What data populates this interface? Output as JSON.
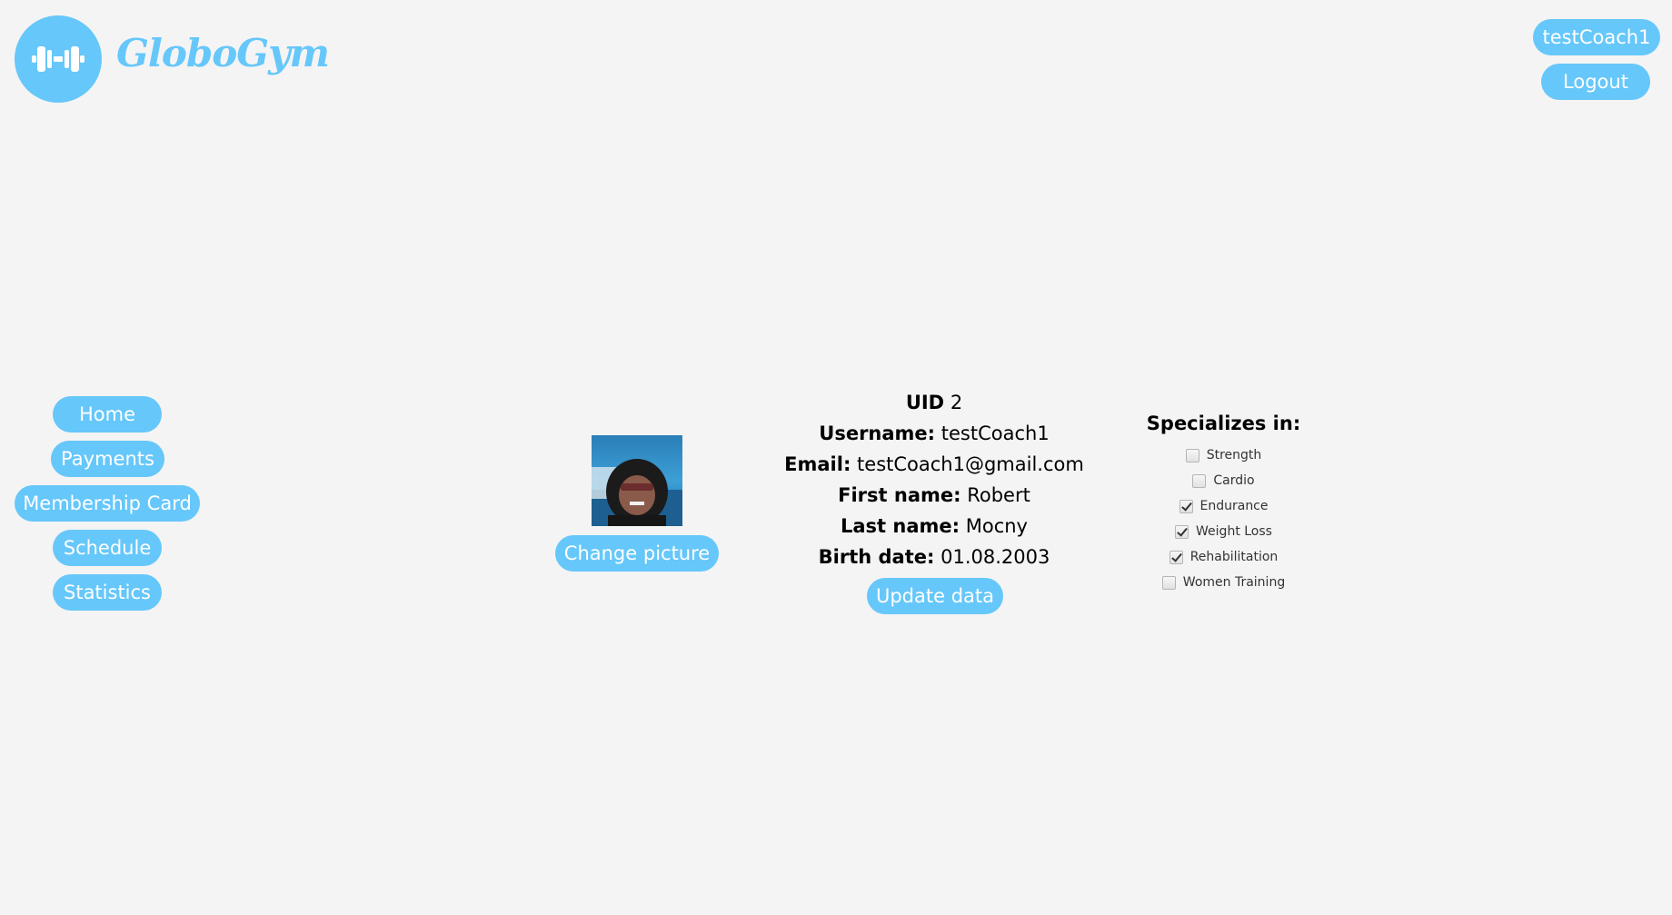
{
  "brand": {
    "name": "GloboGym",
    "logo_icon": "dumbbell-icon",
    "accent_color": "#66c7fa"
  },
  "header": {
    "user_button": "testCoach1",
    "logout_button": "Logout"
  },
  "sidebar": {
    "items": [
      {
        "label": "Home"
      },
      {
        "label": "Payments"
      },
      {
        "label": "Membership Card"
      },
      {
        "label": "Schedule"
      },
      {
        "label": "Statistics"
      }
    ]
  },
  "profile": {
    "photo_icon": "profile-photo",
    "change_picture_button": "Change picture",
    "uid_label": "UID",
    "uid": "2",
    "username_label": "Username:",
    "username": "testCoach1",
    "email_label": "Email:",
    "email": "testCoach1@gmail.com",
    "first_name_label": "First name:",
    "first_name": "Robert",
    "last_name_label": "Last name:",
    "last_name": "Mocny",
    "birth_date_label": "Birth date:",
    "birth_date": "01.08.2003",
    "update_button": "Update data"
  },
  "specializations": {
    "title": "Specializes in:",
    "items": [
      {
        "label": "Strength",
        "checked": false
      },
      {
        "label": "Cardio",
        "checked": false
      },
      {
        "label": "Endurance",
        "checked": true
      },
      {
        "label": "Weight Loss",
        "checked": true
      },
      {
        "label": "Rehabilitation",
        "checked": true
      },
      {
        "label": "Women Training",
        "checked": false
      }
    ]
  }
}
